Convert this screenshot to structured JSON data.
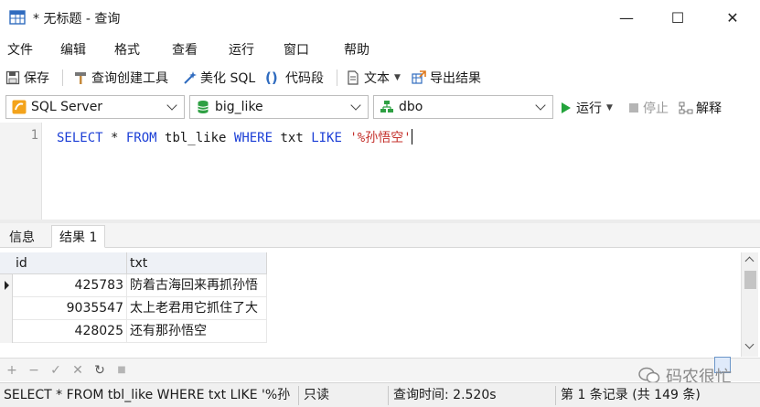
{
  "window": {
    "title": "* 无标题 - 查询",
    "minimize_glyph": "—",
    "maximize_glyph": "☐",
    "close_glyph": "✕"
  },
  "menu": [
    "文件",
    "编辑",
    "格式",
    "查看",
    "运行",
    "窗口",
    "帮助"
  ],
  "toolbar": {
    "save": "保存",
    "query_builder": "查询创建工具",
    "beautify_sql": "美化 SQL",
    "snippet": "代码段",
    "text": "文本",
    "export": "导出结果"
  },
  "connection": {
    "server": "SQL Server",
    "database": "big_like",
    "schema": "dbo",
    "run": "运行",
    "stop": "停止",
    "explain": "解释"
  },
  "editor": {
    "line_number": "1",
    "tokens": {
      "select": "SELECT",
      "star": " * ",
      "from": "FROM",
      "table": " tbl_like ",
      "where": "WHERE",
      "column": " txt ",
      "like": "LIKE",
      "space": " ",
      "literal": "'%孙悟空'"
    }
  },
  "result_tabs": [
    "信息",
    "结果 1"
  ],
  "grid": {
    "columns": [
      "id",
      "txt"
    ],
    "rows": [
      {
        "id": "425783",
        "txt": "防着古海回来再抓孙悟"
      },
      {
        "id": "9035547",
        "txt": "太上老君用它抓住了大"
      },
      {
        "id": "428025",
        "txt": "还有那孙悟空"
      }
    ]
  },
  "editbar": {
    "add": "+",
    "remove": "−",
    "apply": "✓",
    "discard": "✕",
    "refresh": "↻",
    "stop": "■"
  },
  "watermark": "码农很忙",
  "status": {
    "sql": "SELECT * FROM tbl_like WHERE txt LIKE '%孙",
    "mode": "只读",
    "query_time": "查询时间: 2.520s",
    "record": "第 1 条记录 (共 149 条)"
  },
  "colors": {
    "keyword": "#1c3fd6",
    "string": "#c4302b",
    "run_green": "#23a33b"
  }
}
